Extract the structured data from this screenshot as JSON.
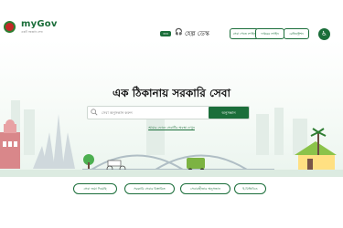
{
  "header": {
    "logo": {
      "title": "myGov",
      "subtitle": "একটি সরকারি সেবা"
    },
    "helpline_badge": "333",
    "helpdesk_label": "হেল্প ডেস্ক",
    "buttons": [
      "সেবা পেতে লগইন",
      "দপ্তরের লগইন",
      "রেজিস্ট্রেশন"
    ],
    "accessibility_icon": "accessibility-icon"
  },
  "hero": {
    "headline": "এক ঠিকানায় সরকারি সেবা",
    "search": {
      "placeholder": "সেবা অনুসন্ধান করুন",
      "button_label": "অনুসন্ধান"
    },
    "voice_link": "আমার ফোনে সেবাটির অবস্থা দেখুন"
  },
  "chips": [
    "সেবা জমা দিয়েছি",
    "সরকারি সেবার বিস্তারিত",
    "সেবাগ্রহীতার অনুসন্ধান",
    "ই-বিভিডিও"
  ],
  "colors": {
    "brand": "#1b6e3a",
    "accent": "#c62828"
  }
}
